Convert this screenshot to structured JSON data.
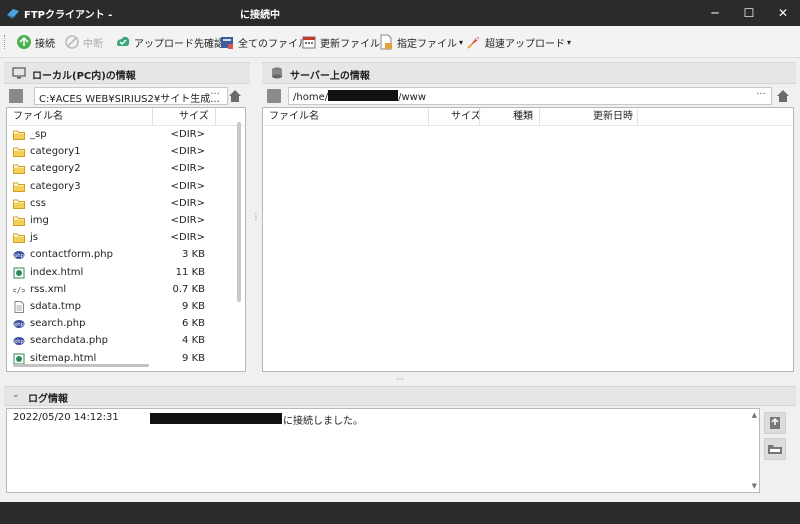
{
  "window": {
    "title": "FTPクライアント -",
    "status": "に接続中",
    "minimize_glyph": "─",
    "maximize_glyph": "☐",
    "close_glyph": "✕"
  },
  "toolbar": {
    "items": [
      {
        "label": "接続",
        "icon": "connect-icon",
        "enabled": true
      },
      {
        "label": "中断",
        "icon": "stop-icon",
        "enabled": false
      },
      {
        "label": "アップロード先確認",
        "icon": "upload-check-icon",
        "enabled": true
      },
      {
        "label": "全てのファイル",
        "icon": "all-files-icon",
        "enabled": true
      },
      {
        "label": "更新ファイル",
        "icon": "updated-files-icon",
        "enabled": true
      },
      {
        "label": "指定ファイル",
        "icon": "specified-file-icon",
        "enabled": true,
        "dropdown": true
      },
      {
        "label": "超速アップロード",
        "icon": "fast-upload-icon",
        "enabled": true,
        "dropdown": true
      }
    ]
  },
  "local": {
    "title": "ローカル(PC内)の情報",
    "path": "C:¥ACES WEB¥SIRIUS2¥サイト生成...",
    "more": "···",
    "columns": {
      "name": "ファイル名",
      "size": "サイズ"
    },
    "files": [
      {
        "name": "_sp",
        "size": "<DIR>",
        "icon": "folder-icon"
      },
      {
        "name": "category1",
        "size": "<DIR>",
        "icon": "folder-icon"
      },
      {
        "name": "category2",
        "size": "<DIR>",
        "icon": "folder-icon"
      },
      {
        "name": "category3",
        "size": "<DIR>",
        "icon": "folder-icon"
      },
      {
        "name": "css",
        "size": "<DIR>",
        "icon": "folder-icon"
      },
      {
        "name": "img",
        "size": "<DIR>",
        "icon": "folder-icon"
      },
      {
        "name": "js",
        "size": "<DIR>",
        "icon": "folder-icon"
      },
      {
        "name": "contactform.php",
        "size": "3 KB",
        "icon": "php-file-icon"
      },
      {
        "name": "index.html",
        "size": "11 KB",
        "icon": "html-file-icon"
      },
      {
        "name": "rss.xml",
        "size": "0.7 KB",
        "icon": "xml-file-icon"
      },
      {
        "name": "sdata.tmp",
        "size": "9 KB",
        "icon": "text-file-icon"
      },
      {
        "name": "search.php",
        "size": "6 KB",
        "icon": "php-file-icon"
      },
      {
        "name": "searchdata.php",
        "size": "4 KB",
        "icon": "php-file-icon"
      },
      {
        "name": "sitemap.html",
        "size": "9 KB",
        "icon": "html-file-icon"
      }
    ]
  },
  "server": {
    "title": "サーバー上の情報",
    "path_prefix": "/home/",
    "path_suffix": "/www",
    "more": "···",
    "columns": {
      "name": "ファイル名",
      "size": "サイズ",
      "type": "種類",
      "modified": "更新日時"
    }
  },
  "log": {
    "title": "ログ情報",
    "entries": [
      {
        "time": "2022/05/20 14:12:31",
        "message": "に接続しました。"
      }
    ]
  },
  "colors": {
    "titlebar": "#2b2b2b",
    "folder": "#e8b430",
    "php": "#3b4fa0",
    "html": "#2e8b57",
    "connect": "#4caf50"
  }
}
